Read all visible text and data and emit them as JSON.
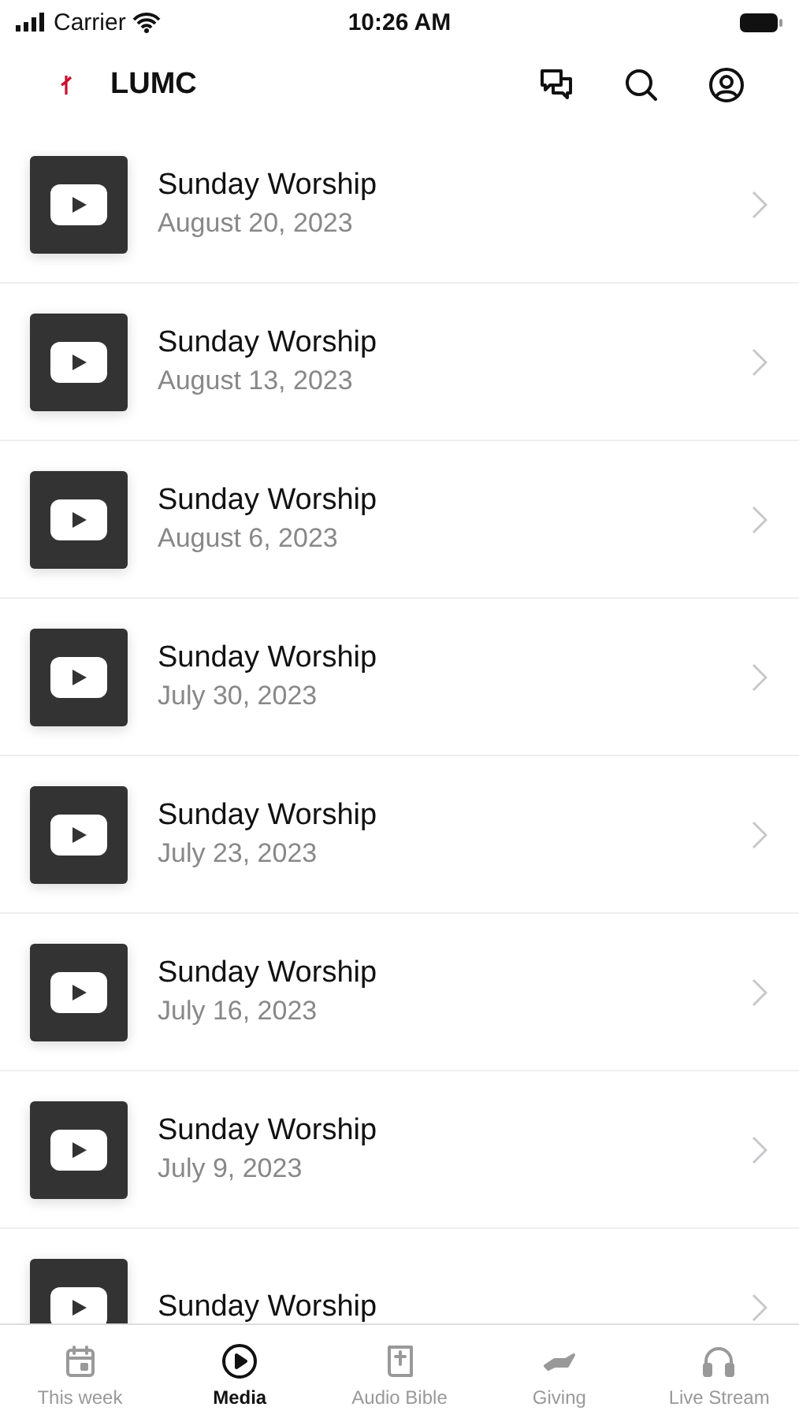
{
  "status_bar": {
    "carrier": "Carrier",
    "time": "10:26 AM"
  },
  "header": {
    "title": "LUMC"
  },
  "videos": [
    {
      "title": "Sunday Worship",
      "date": "August 20, 2023"
    },
    {
      "title": "Sunday Worship",
      "date": "August 13, 2023"
    },
    {
      "title": "Sunday Worship",
      "date": "August 6, 2023"
    },
    {
      "title": "Sunday Worship",
      "date": "July 30, 2023"
    },
    {
      "title": "Sunday Worship",
      "date": "July 23, 2023"
    },
    {
      "title": "Sunday Worship",
      "date": "July 16, 2023"
    },
    {
      "title": "Sunday Worship",
      "date": "July 9, 2023"
    },
    {
      "title": "Sunday Worship"
    }
  ],
  "tab_bar": [
    {
      "label": "This week",
      "kind": "calendar",
      "selected": false
    },
    {
      "label": "Media",
      "kind": "play",
      "selected": true
    },
    {
      "label": "Audio Bible",
      "kind": "bible",
      "selected": false
    },
    {
      "label": "Giving",
      "kind": "giving",
      "selected": false
    },
    {
      "label": "Live Stream",
      "kind": "headphones",
      "selected": false
    }
  ]
}
